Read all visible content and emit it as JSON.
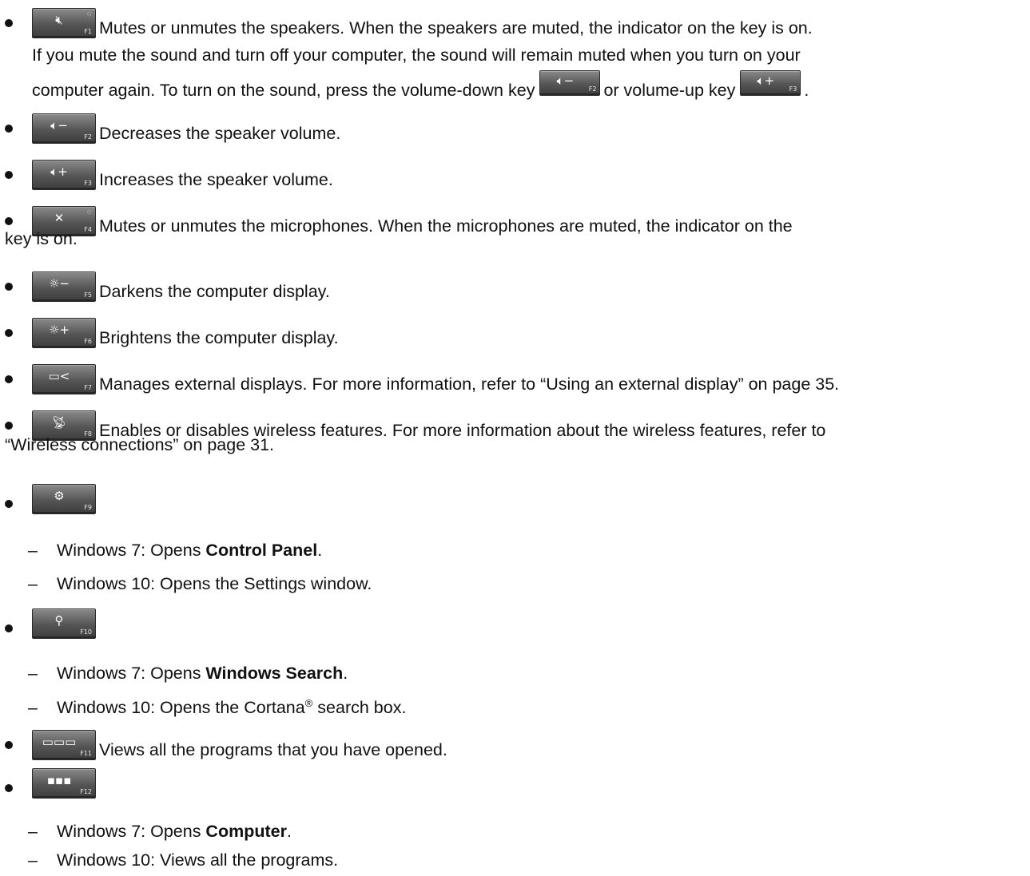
{
  "items": [
    {
      "key": {
        "icon": "speaker-mute-icon",
        "symbol": "🔇︎",
        "fn": "F1"
      },
      "text": "Mutes or unmutes the speakers. When the speakers are muted, the indicator on the key is on.",
      "continuation_line1": "If you mute the sound and turn off your computer, the sound will remain muted when you turn on your",
      "continuation_line2_part1": "computer again. To turn on the sound, press the volume-down key",
      "continuation_line2_part2": "or volume-up key",
      "continuation_line2_end": "."
    },
    {
      "key": {
        "icon": "volume-down-icon",
        "symbol": "🔈︎−",
        "fn": "F2"
      },
      "text": "Decreases the speaker volume."
    },
    {
      "key": {
        "icon": "volume-up-icon",
        "symbol": "🔈︎+",
        "fn": "F3"
      },
      "text": "Increases the speaker volume."
    },
    {
      "key": {
        "icon": "microphone-mute-icon",
        "symbol": "✕",
        "fn": "F4"
      },
      "text_line1": "Mutes or unmutes the microphones. When the microphones are muted, the indicator on the",
      "text_line2": "key is on."
    },
    {
      "key": {
        "icon": "brightness-down-icon",
        "symbol": "☼−",
        "fn": "F5"
      },
      "text": "Darkens the computer display."
    },
    {
      "key": {
        "icon": "brightness-up-icon",
        "symbol": "☼+",
        "fn": "F6"
      },
      "text": "Brightens the computer display."
    },
    {
      "key": {
        "icon": "external-display-icon",
        "symbol": "▭<",
        "fn": "F7"
      },
      "text": "Manages external displays. For more information, refer to “Using an external display” on page 35."
    },
    {
      "key": {
        "icon": "wireless-icon",
        "symbol": "📡︎",
        "fn": "F8"
      },
      "text_line1": "Enables or disables wireless features. For more information about the wireless features, refer to",
      "text_line2": "“Wireless connections” on page 31."
    },
    {
      "key": {
        "icon": "settings-gear-icon",
        "symbol": "⚙",
        "fn": "F9"
      },
      "subitems": [
        {
          "prefix": "Windows 7: Opens ",
          "bold": "Control Panel",
          "suffix": "."
        },
        {
          "prefix": "Windows 10: Opens the Settings window.",
          "bold": "",
          "suffix": ""
        }
      ]
    },
    {
      "key": {
        "icon": "search-icon",
        "symbol": "⚲",
        "fn": "F10"
      },
      "subitems": [
        {
          "prefix": "Windows 7: Opens ",
          "bold": "Windows Search",
          "suffix": "."
        },
        {
          "prefix": "Windows 10: Opens the Cortana",
          "sup": "®",
          "suffix": " search box."
        }
      ]
    },
    {
      "key": {
        "icon": "task-view-icon",
        "symbol": "▭▭▭",
        "fn": "F11"
      },
      "text": "Views all the programs that you have opened."
    },
    {
      "key": {
        "icon": "all-apps-grid-icon",
        "symbol": "▪▪▪",
        "fn": "F12"
      },
      "subitems": [
        {
          "prefix": "Windows 7: Opens ",
          "bold": "Computer",
          "suffix": "."
        },
        {
          "prefix": "Windows 10: Views all the programs.",
          "bold": "",
          "suffix": ""
        }
      ]
    }
  ],
  "dash": "–"
}
